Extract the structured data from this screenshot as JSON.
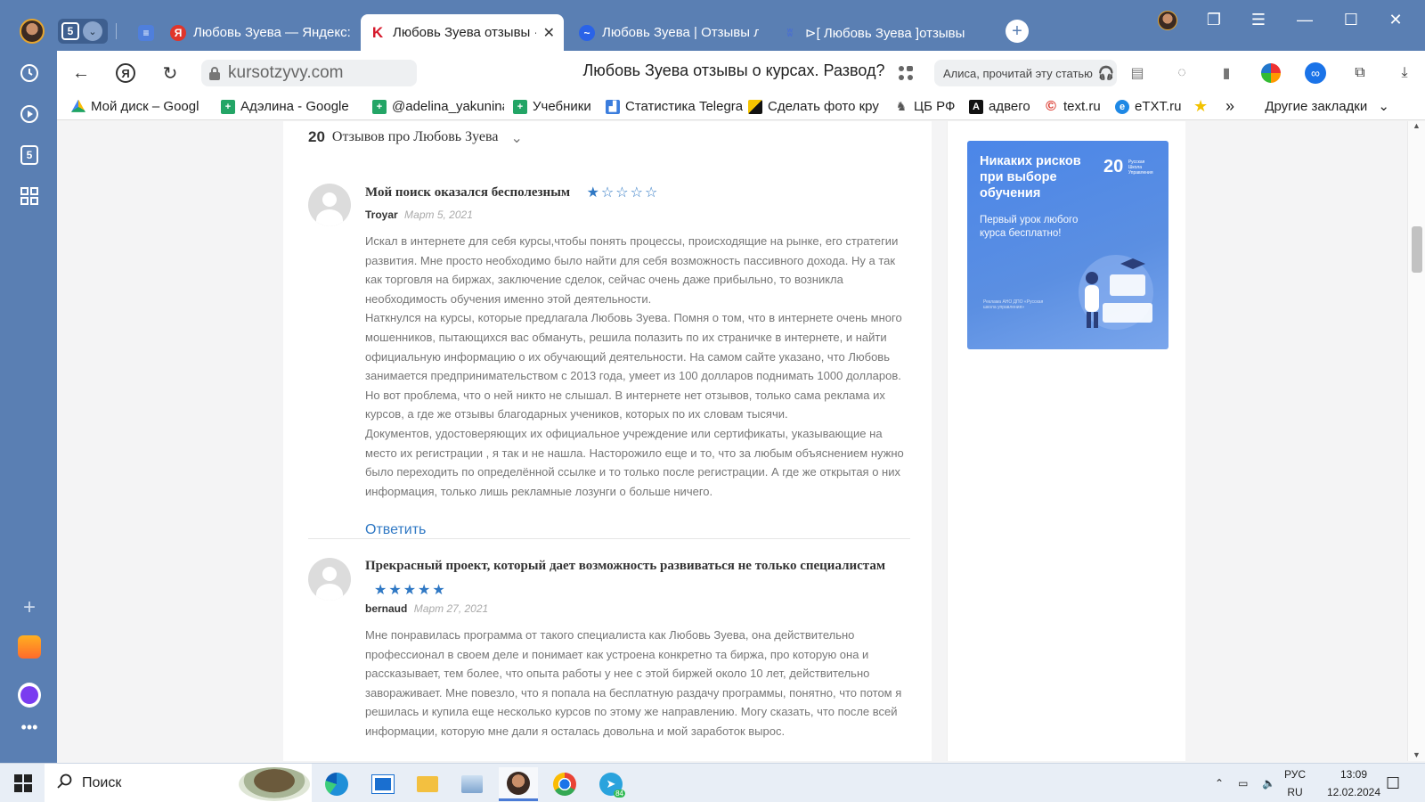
{
  "browser": {
    "tab_group_count": "5",
    "tabs": [
      {
        "label": "",
        "icon": "docs-icon",
        "color": "#4f7fdc"
      },
      {
        "label": "Любовь Зуева — Яндекс:",
        "icon": "yandex-icon",
        "color": "#e0352b"
      },
      {
        "label": "Любовь Зуева отзывы ·",
        "icon": "kursotzyvy-icon",
        "color": "#d6192b"
      },
      {
        "label": "Любовь Зуева | Отзывы л",
        "icon": "review-site-icon",
        "color": "#2a63e8"
      },
      {
        "label": "⊳[ Любовь Зуева ]отзывы",
        "icon": "site-icon",
        "color": "#4a6fd0"
      }
    ],
    "new_tab": "+",
    "close_tab": "✕",
    "url": "kursotzyvy.com",
    "page_title": "Любовь Зуева отзывы о курсах. Развод?",
    "alice_label": "Алиса, прочитай эту статью",
    "bookmarks": [
      {
        "label": "Мой диск – Googl",
        "icon": "google-drive-icon",
        "color": "#1fa463"
      },
      {
        "label": "Адэлина - Google",
        "icon": "google-sheets-icon",
        "color": "#23a566"
      },
      {
        "label": "@adelina_yakunina",
        "icon": "google-sheets-icon",
        "color": "#23a566"
      },
      {
        "label": "Учебники",
        "icon": "google-sheets-icon",
        "color": "#23a566"
      },
      {
        "label": "Статистика Telegra",
        "icon": "chart-icon",
        "color": "#3b7ddd"
      },
      {
        "label": "Сделать фото кру",
        "icon": "photo-icon",
        "color": "#111111"
      },
      {
        "label": "ЦБ РФ",
        "icon": "cbr-icon",
        "color": "#555555"
      },
      {
        "label": "адвего",
        "icon": "advego-icon",
        "color": "#111111"
      },
      {
        "label": "text.ru",
        "icon": "textru-icon",
        "color": "#d93025"
      },
      {
        "label": "eTXT.ru",
        "icon": "etxt-icon",
        "color": "#1e88e5"
      },
      {
        "label": "",
        "icon": "star-icon",
        "color": "#f2c200"
      }
    ],
    "more_bookmarks": "»",
    "other_bookmarks": "Другие закладки"
  },
  "sidebar": {
    "badge": "5"
  },
  "page": {
    "reviews_count": "20",
    "reviews_label": "Отзывов про Любовь Зуева",
    "reviews": [
      {
        "title": "Мой поиск оказался бесполезным",
        "rating": 1,
        "author": "Troyar",
        "date": "Март 5, 2021",
        "paragraphs": [
          "Искал в интернете для себя курсы,чтобы понять процессы, происходящие на рынке, его стратегии развития. Мне просто необходимо было найти для себя возможность пассивного дохода. Ну а так как торговля на биржах, заключение сделок, сейчас очень даже прибыльно, то возникла необходимость обучения именно этой деятельности.",
          "Наткнулся на курсы, которые предлагала Любовь Зуева. Помня о том, что в интернете очень много мошенников, пытающихся вас обмануть, решила полазить по их страничке в интернете, и найти официальную информацию о их обучающий деятельности. На самом сайте указано, что Любовь занимается предпринимательством с 2013 года, умеет из 100 долларов поднимать 1000 долларов. Но вот проблема, что о ней никто не слышал. В интернете нет отзывов, только сама реклама их курсов, а где же отзывы благодарных учеников, которых по их словам тысячи.",
          "Документов, удостоверяющих их официальное учреждение или сертификаты, указывающие на место их регистрации , я так и не нашла. Насторожило еще и то, что за любым объяснением нужно было переходить по определённой ссылке и то только после регистрации. А где же открытая о них информация, только лишь рекламные лозунги о больше ничего."
        ],
        "reply": "Ответить"
      },
      {
        "title": "Прекрасный проект, который дает возможность развиваться не только специалистам",
        "rating": 5,
        "author": "bernaud",
        "date": "Март 27, 2021",
        "paragraphs": [
          "Мне понравилась программа от такого специалиста как Любовь Зуева, она действительно профессионал в своем деле и понимает как устроена конкретно та биржа, про которую она и рассказывает, тем более, что опыта работы у нее с этой биржей около 10 лет, действительно завораживает. Мне повезло, что я попала на бесплатную раздачу программы, понятно, что потом я решилась и купила еще несколько курсов по этому же направлению. Могу сказать, что после всей информации, которую мне дали я осталась довольна и мой заработок вырос."
        ]
      }
    ],
    "ad": {
      "title": "Никаких рисков при выборе обучения",
      "subtitle": "Первый урок любого курса бесплатно!",
      "logo_number": "20",
      "logo_text": "Русская Школа Управления",
      "fine_print": "Реклама АНО ДПО «Русская школа управления»",
      "bg_color": "#4b86e8"
    }
  },
  "taskbar": {
    "search_label": "Поиск",
    "lang_top": "РУС",
    "lang_bottom": "RU",
    "time": "13:09",
    "date": "12.02.2024",
    "telegram_badge": "84"
  }
}
